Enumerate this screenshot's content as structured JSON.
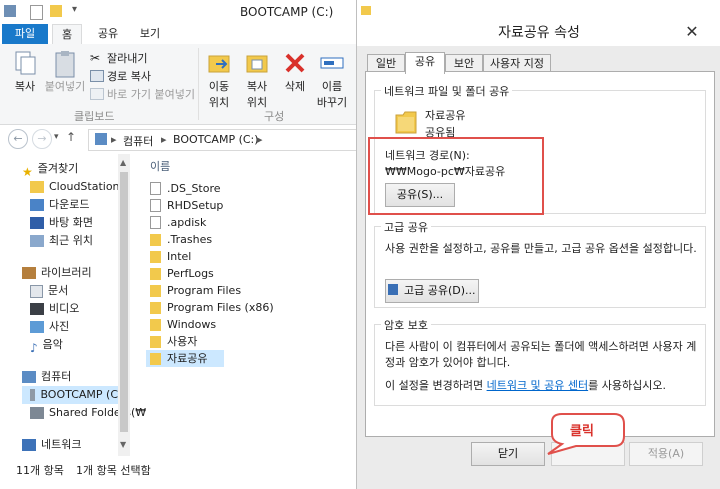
{
  "explorer": {
    "title": "BOOTCAMP (C:)",
    "ribbon_tabs": [
      "파일",
      "홈",
      "공유",
      "보기"
    ],
    "ribbon": {
      "copy": "복사",
      "paste": "붙여넣기",
      "cut": "잘라내기",
      "copy_path": "경로 복사",
      "paste_shortcut": "바로 가기 붙여넣기",
      "clipboard_group": "클립보드",
      "move_to_line1": "이동",
      "move_to_line2": "위치",
      "copy_to_line1": "복사",
      "copy_to_line2": "위치",
      "delete": "삭제",
      "rename_line1": "이름",
      "rename_line2": "바꾸기",
      "organize_group": "구성"
    },
    "address": {
      "segments": [
        "컴퓨터",
        "BOOTCAMP (C:)"
      ]
    },
    "nav": {
      "favorites": "즐겨찾기",
      "favorites_items": [
        "CloudStation",
        "다운로드",
        "바탕 화면",
        "최근 위치"
      ],
      "libraries": "라이브러리",
      "library_items": [
        "문서",
        "비디오",
        "사진",
        "음악"
      ],
      "computer": "컴퓨터",
      "computer_items": [
        "BOOTCAMP (C:)",
        "Shared Folders(₩"
      ],
      "network": "네트워크"
    },
    "column_header": "이름",
    "files": [
      ".DS_Store",
      "RHDSetup",
      ".apdisk",
      ".Trashes",
      "Intel",
      "PerfLogs",
      "Program Files",
      "Program Files (x86)",
      "Windows",
      "사용자",
      "자료공유"
    ],
    "status_count": "11개 항목",
    "status_selected": "1개 항목 선택함"
  },
  "dialog": {
    "title": "자료공유 속성",
    "tabs": [
      "일반",
      "공유",
      "보안",
      "사용자 지정"
    ],
    "network_sharing": {
      "group_title": "네트워크 파일 및 폴더 공유",
      "folder_name": "자료공유",
      "share_state": "공유됨",
      "path_label": "네트워크 경로(N):",
      "path_value": "₩₩Mogo-pc₩자료공유",
      "share_button": "공유(S)..."
    },
    "advanced": {
      "group_title": "고급 공유",
      "description": "사용 권한을 설정하고, 공유를 만들고, 고급 공유 옵션을 설정합니다.",
      "button": "고급 공유(D)..."
    },
    "password": {
      "group_title": "암호 보호",
      "description": "다른 사람이 이 컴퓨터에서 공유되는 폴더에 액세스하려면 사용자 계정과 암호가 있어야 합니다.",
      "change_prefix": "이 설정을 변경하려면 ",
      "change_link": "네트워크 및 공유 센터",
      "change_suffix": "를 사용하십시오."
    },
    "close_button": "닫기",
    "apply_button": "적용(A)"
  },
  "annotation": {
    "bubble_text": "클릭",
    "highlight_color": "#e0504b"
  }
}
